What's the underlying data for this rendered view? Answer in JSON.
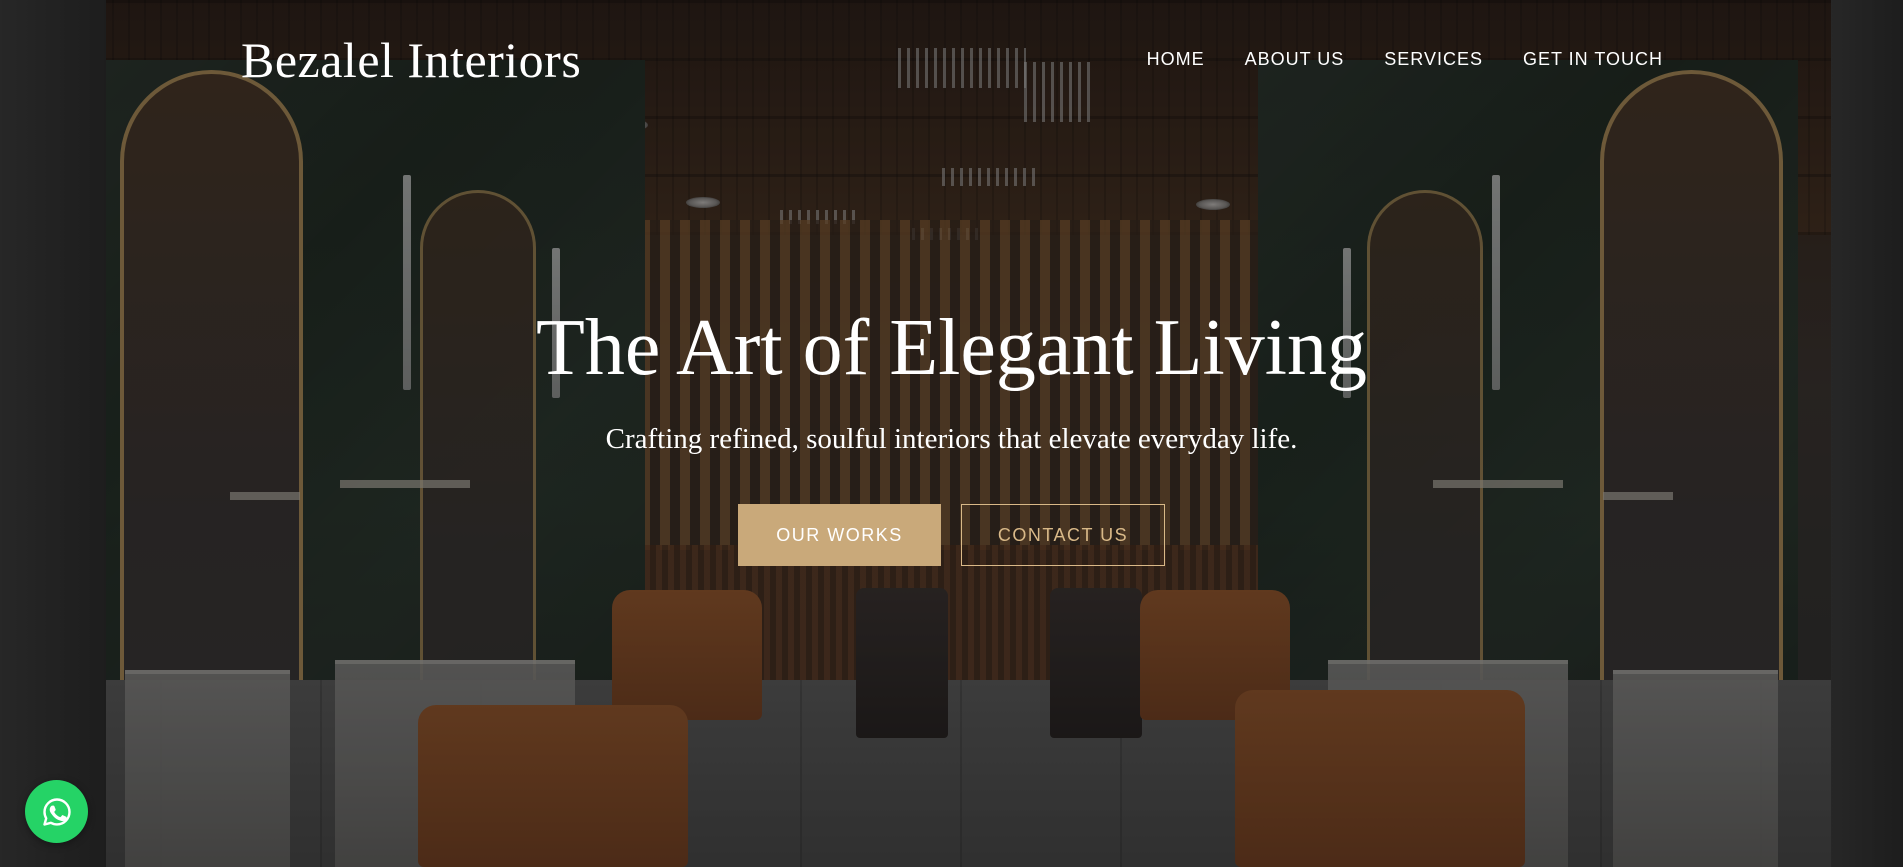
{
  "brand": {
    "name": "Bezalel Interiors"
  },
  "nav": {
    "items": [
      {
        "label": "HOME"
      },
      {
        "label": "ABOUT US"
      },
      {
        "label": "SERVICES"
      },
      {
        "label": "GET IN TOUCH"
      }
    ]
  },
  "hero": {
    "title": "The Art of Elegant Living",
    "subtitle": "Crafting refined, soulful interiors that elevate everyday life.",
    "primary_button": "OUR WORKS",
    "secondary_button": "CONTACT US"
  },
  "floating": {
    "whatsapp_icon": "whatsapp-icon"
  },
  "colors": {
    "accent_gold": "#c9a97a",
    "outline_gold": "#d9b988",
    "whatsapp_green": "#25d366",
    "text_white": "#ffffff"
  }
}
